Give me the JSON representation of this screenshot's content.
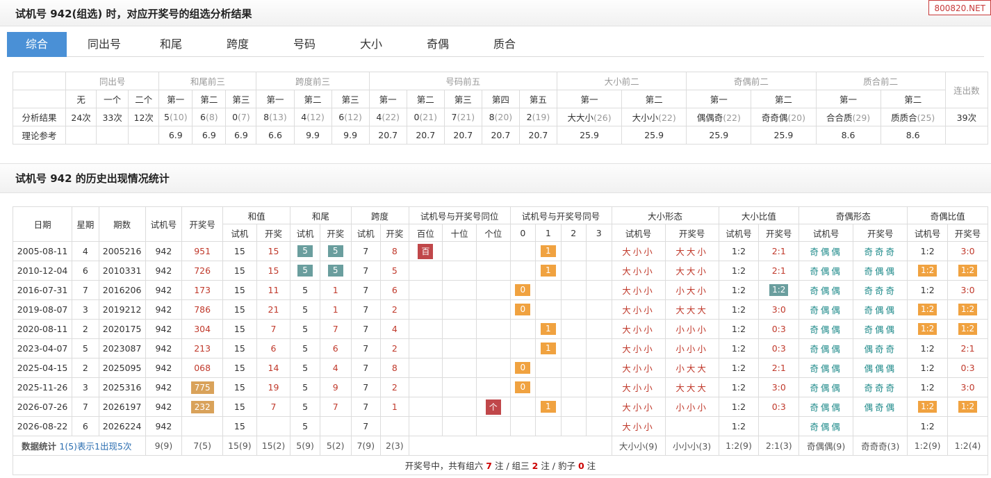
{
  "header": {
    "title": "试机号 942(组选) 时，对应开奖号的组选分析结果",
    "badge": "800820.NET"
  },
  "tabs": [
    "综合",
    "同出号",
    "和尾",
    "跨度",
    "号码",
    "大小",
    "奇偶",
    "质合"
  ],
  "analysis": {
    "groups": [
      "同出号",
      "和尾前三",
      "跨度前三",
      "号码前五",
      "大小前二",
      "奇偶前二",
      "质合前二",
      "连出数"
    ],
    "sub": [
      "无",
      "一个",
      "二个",
      "第一",
      "第二",
      "第三",
      "第一",
      "第二",
      "第三",
      "第一",
      "第二",
      "第三",
      "第四",
      "第五",
      "第一",
      "第二",
      "第一",
      "第二",
      "第一",
      "第二"
    ],
    "row1_label": "分析结果",
    "row1": [
      {
        "v": "24次"
      },
      {
        "v": "33次"
      },
      {
        "v": "12次"
      },
      {
        "v": "5",
        "g": "(10)"
      },
      {
        "v": "6",
        "g": "(8)"
      },
      {
        "v": "0",
        "g": "(7)"
      },
      {
        "v": "8",
        "g": "(13)"
      },
      {
        "v": "4",
        "g": "(12)"
      },
      {
        "v": "6",
        "g": "(12)"
      },
      {
        "v": "4",
        "g": "(22)"
      },
      {
        "v": "0",
        "g": "(21)"
      },
      {
        "v": "7",
        "g": "(21)"
      },
      {
        "v": "8",
        "g": "(20)"
      },
      {
        "v": "2",
        "g": "(19)"
      },
      {
        "v": "大大小",
        "g": "(26)"
      },
      {
        "v": "大小小",
        "g": "(22)"
      },
      {
        "v": "偶偶奇",
        "g": "(22)"
      },
      {
        "v": "奇奇偶",
        "g": "(20)"
      },
      {
        "v": "合合质",
        "g": "(29)"
      },
      {
        "v": "质质合",
        "g": "(25)"
      },
      {
        "v": "39次"
      }
    ],
    "row2_label": "理论参考",
    "row2": [
      "",
      "",
      "",
      "6.9",
      "6.9",
      "6.9",
      "6.6",
      "9.9",
      "9.9",
      "20.7",
      "20.7",
      "20.7",
      "20.7",
      "20.7",
      "25.9",
      "25.9",
      "25.9",
      "25.9",
      "8.6",
      "8.6",
      ""
    ]
  },
  "history": {
    "title": "试机号 942 的历史出现情况统计",
    "head1": [
      "日期",
      "星期",
      "期数",
      "试机号",
      "开奖号",
      "和值",
      "和尾",
      "跨度",
      "试机号与开奖号同位",
      "试机号与开奖号同号",
      "大小形态",
      "大小比值",
      "奇偶形态",
      "奇偶比值"
    ],
    "head2": [
      "试机",
      "开奖",
      "试机",
      "开奖",
      "试机",
      "开奖",
      "百位",
      "十位",
      "个位",
      "0",
      "1",
      "2",
      "3",
      "试机号",
      "开奖号",
      "试机号",
      "开奖号",
      "试机号",
      "开奖号",
      "试机号",
      "开奖号"
    ],
    "rows": [
      {
        "date": "2005-08-11",
        "week": "4",
        "issue": "2005216",
        "sj": "942",
        "kj": "951",
        "kjHL": false,
        "hz1": "15",
        "hz2": "15",
        "hw1": "5",
        "hw2": "5",
        "hwHL": true,
        "kd1": "7",
        "kd2": "8",
        "tw": [
          "百",
          "",
          ""
        ],
        "th": [
          "",
          "1",
          "",
          ""
        ],
        "dx1": "大小小",
        "dx2": "大大小",
        "db1": "1:2",
        "db2": "2:1",
        "dbHL": false,
        "jo1": "奇偶偶",
        "jo2": "奇奇奇",
        "jb1": "1:2",
        "jb2": "3:0",
        "jbHL": false
      },
      {
        "date": "2010-12-04",
        "week": "6",
        "issue": "2010331",
        "sj": "942",
        "kj": "726",
        "kjHL": false,
        "hz1": "15",
        "hz2": "15",
        "hw1": "5",
        "hw2": "5",
        "hwHL": true,
        "kd1": "7",
        "kd2": "5",
        "tw": [
          "",
          "",
          ""
        ],
        "th": [
          "",
          "1",
          "",
          ""
        ],
        "dx1": "大小小",
        "dx2": "大大小",
        "db1": "1:2",
        "db2": "2:1",
        "dbHL": false,
        "jo1": "奇偶偶",
        "jo2": "奇偶偶",
        "jb1": "1:2",
        "jb2": "1:2",
        "jbHL": true
      },
      {
        "date": "2016-07-31",
        "week": "7",
        "issue": "2016206",
        "sj": "942",
        "kj": "173",
        "kjHL": false,
        "hz1": "15",
        "hz2": "11",
        "hw1": "5",
        "hw2": "1",
        "hwHL": false,
        "kd1": "7",
        "kd2": "6",
        "tw": [
          "",
          "",
          ""
        ],
        "th": [
          "0",
          "",
          "",
          ""
        ],
        "dx1": "大小小",
        "dx2": "小大小",
        "db1": "1:2",
        "db2": "1:2",
        "dbHL": true,
        "jo1": "奇偶偶",
        "jo2": "奇奇奇",
        "jb1": "1:2",
        "jb2": "3:0",
        "jbHL": false
      },
      {
        "date": "2019-08-07",
        "week": "3",
        "issue": "2019212",
        "sj": "942",
        "kj": "786",
        "kjHL": false,
        "hz1": "15",
        "hz2": "21",
        "hw1": "5",
        "hw2": "1",
        "hwHL": false,
        "kd1": "7",
        "kd2": "2",
        "tw": [
          "",
          "",
          ""
        ],
        "th": [
          "0",
          "",
          "",
          ""
        ],
        "dx1": "大小小",
        "dx2": "大大大",
        "db1": "1:2",
        "db2": "3:0",
        "dbHL": false,
        "jo1": "奇偶偶",
        "jo2": "奇偶偶",
        "jb1": "1:2",
        "jb2": "1:2",
        "jbHL": true
      },
      {
        "date": "2020-08-11",
        "week": "2",
        "issue": "2020175",
        "sj": "942",
        "kj": "304",
        "kjHL": false,
        "hz1": "15",
        "hz2": "7",
        "hw1": "5",
        "hw2": "7",
        "hwHL": false,
        "kd1": "7",
        "kd2": "4",
        "tw": [
          "",
          "",
          ""
        ],
        "th": [
          "",
          "1",
          "",
          ""
        ],
        "dx1": "大小小",
        "dx2": "小小小",
        "db1": "1:2",
        "db2": "0:3",
        "dbHL": false,
        "jo1": "奇偶偶",
        "jo2": "奇偶偶",
        "jb1": "1:2",
        "jb2": "1:2",
        "jbHL": true
      },
      {
        "date": "2023-04-07",
        "week": "5",
        "issue": "2023087",
        "sj": "942",
        "kj": "213",
        "kjHL": false,
        "hz1": "15",
        "hz2": "6",
        "hw1": "5",
        "hw2": "6",
        "hwHL": false,
        "kd1": "7",
        "kd2": "2",
        "tw": [
          "",
          "",
          ""
        ],
        "th": [
          "",
          "1",
          "",
          ""
        ],
        "dx1": "大小小",
        "dx2": "小小小",
        "db1": "1:2",
        "db2": "0:3",
        "dbHL": false,
        "jo1": "奇偶偶",
        "jo2": "偶奇奇",
        "jb1": "1:2",
        "jb2": "2:1",
        "jbHL": false
      },
      {
        "date": "2025-04-15",
        "week": "2",
        "issue": "2025095",
        "sj": "942",
        "kj": "068",
        "kjHL": false,
        "hz1": "15",
        "hz2": "14",
        "hw1": "5",
        "hw2": "4",
        "hwHL": false,
        "kd1": "7",
        "kd2": "8",
        "tw": [
          "",
          "",
          ""
        ],
        "th": [
          "0",
          "",
          "",
          ""
        ],
        "dx1": "大小小",
        "dx2": "小大大",
        "db1": "1:2",
        "db2": "2:1",
        "dbHL": false,
        "jo1": "奇偶偶",
        "jo2": "偶偶偶",
        "jb1": "1:2",
        "jb2": "0:3",
        "jbHL": false
      },
      {
        "date": "2025-11-26",
        "week": "3",
        "issue": "2025316",
        "sj": "942",
        "kj": "775",
        "kjHL": true,
        "hz1": "15",
        "hz2": "19",
        "hw1": "5",
        "hw2": "9",
        "hwHL": false,
        "kd1": "7",
        "kd2": "2",
        "tw": [
          "",
          "",
          ""
        ],
        "th": [
          "0",
          "",
          "",
          ""
        ],
        "dx1": "大小小",
        "dx2": "大大大",
        "db1": "1:2",
        "db2": "3:0",
        "dbHL": false,
        "jo1": "奇偶偶",
        "jo2": "奇奇奇",
        "jb1": "1:2",
        "jb2": "3:0",
        "jbHL": false
      },
      {
        "date": "2026-07-26",
        "week": "7",
        "issue": "2026197",
        "sj": "942",
        "kj": "232",
        "kjHL": true,
        "hz1": "15",
        "hz2": "7",
        "hw1": "5",
        "hw2": "7",
        "hwHL": false,
        "kd1": "7",
        "kd2": "1",
        "tw": [
          "",
          "",
          "个"
        ],
        "th": [
          "",
          "1",
          "",
          ""
        ],
        "dx1": "大小小",
        "dx2": "小小小",
        "db1": "1:2",
        "db2": "0:3",
        "dbHL": false,
        "jo1": "奇偶偶",
        "jo2": "偶奇偶",
        "jb1": "1:2",
        "jb2": "1:2",
        "jbHL": true
      },
      {
        "date": "2026-08-22",
        "week": "6",
        "issue": "2026224",
        "sj": "942",
        "kj": "",
        "kjHL": false,
        "hz1": "15",
        "hz2": "",
        "hw1": "5",
        "hw2": "",
        "hwHL": false,
        "kd1": "7",
        "kd2": "",
        "tw": [
          "",
          "",
          ""
        ],
        "th": [
          "",
          "",
          "",
          ""
        ],
        "dx1": "大小小",
        "dx2": "",
        "db1": "1:2",
        "db2": "",
        "dbHL": false,
        "jo1": "奇偶偶",
        "jo2": "",
        "jb1": "1:2",
        "jb2": "",
        "jbHL": false
      }
    ],
    "stats": {
      "label": "数据统计",
      "note": "1(5)表示1出现5次",
      "sj": "9(9)",
      "kj": "7(5)",
      "hz1": "15(9)",
      "hz2": "15(2)",
      "hw1": "5(9)",
      "hw2": "5(2)",
      "kd1": "7(9)",
      "kd2": "2(3)",
      "dx1": "大小小(9)",
      "dx2": "小小小(3)",
      "db1": "1:2(9)",
      "db2": "2:1(3)",
      "jo1": "奇偶偶(9)",
      "jo2": "奇奇奇(3)",
      "jb1": "1:2(9)",
      "jb2": "1:2(4)"
    },
    "footer": {
      "pre": "开奖号中，共有组六",
      "n1": "7",
      "t1": "注 / 组三",
      "n2": "2",
      "t2": "注 / 豹子",
      "n3": "0",
      "t3": "注"
    }
  }
}
